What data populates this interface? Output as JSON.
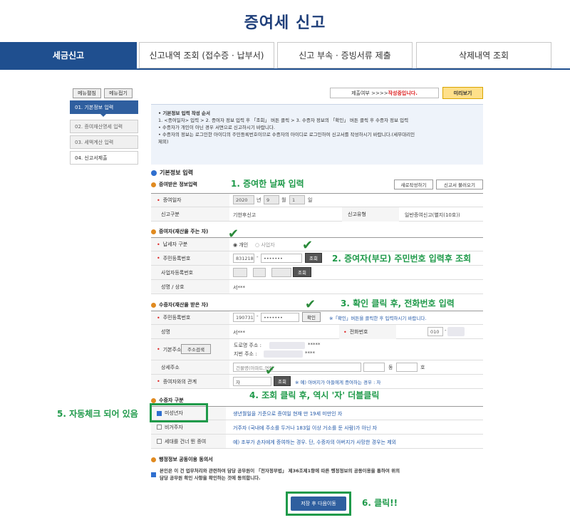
{
  "page_title": "증여세 신고",
  "tabs": [
    "세금신고",
    "신고내역 조회 (접수증 · 납부서)",
    "신고 부속 · 증빙서류 제출",
    "삭제내역 조회"
  ],
  "sidebar": {
    "expand": "메뉴펼침",
    "collapse": "메뉴접기",
    "steps": [
      "01. 기본정보 입력",
      "02. 증여재산명세 입력",
      "03. 세액계산 입력",
      "04. 신고서제출"
    ]
  },
  "status": {
    "label": "제출여부 >>>> ",
    "state": "작성중입니다.",
    "preview": "미리보기"
  },
  "info": {
    "heading": "• 기본정보 입력 작성 순서",
    "lines": [
      "1. <증여일자> 입력 > 2. 증여자 정보 입력 후 「조회」 버튼 클릭 > 3. 수증자 정보의 「확인」 버튼 클릭 후 수증자 정보 입력",
      "• 수증자가 개인이 아닌 경우 서면으로 신고하시기 바랍니다.",
      "• 수증자의 정보는 로그인한 아이디의 주민등록번호이므로 수증자의 아이디로 로그인하여 신고서를 작성하시기 바랍니다.(세무대리인",
      "제외)"
    ]
  },
  "basic": {
    "title": "기본정보 입력",
    "received": "증여받은 정보입력",
    "new_btn": "새로작성하기",
    "load_btn": "신고서 불러오기",
    "date_label": "증여일자",
    "year": "2020",
    "year_unit": "년",
    "month": "9",
    "month_unit": "월",
    "day": "1",
    "day_unit": "일",
    "type_label": "신고구분",
    "type_value": "기한후신고",
    "kind_label": "신고유형",
    "kind_value": "일반증여신고(별지(10호))"
  },
  "donor": {
    "title": "증여자(재산을 주는 자)",
    "payer_label": "납세자 구분",
    "opt_person": "개인",
    "opt_business": "사업자",
    "rrn_label": "주민등록번호",
    "rrn_front": "831218",
    "rrn_back": "•••••••",
    "lookup": "조회",
    "biz_label": "사업자등록번호",
    "biz_lookup": "조회",
    "name_label": "성명 / 상호",
    "name_value": "서***"
  },
  "recipient": {
    "title": "수증자(재산을 받은 자)",
    "rrn_label": "주민등록번호",
    "rrn_front": "190731",
    "rrn_back": "•••••••",
    "confirm": "확인",
    "confirm_note": "※「확인」버튼을 클릭한 후 입력하시기 바랍니다.",
    "name_label": "성명",
    "name_value": "서***",
    "phone_label": "전화번호",
    "phone_prefix": "010",
    "phone_dash": "-",
    "addr_label": "기본주소",
    "addr_btn": "주소검색",
    "road_addr": "도로명 주소 :",
    "jibun_addr": "지번 주소 :",
    "road_mask": "*****",
    "jibun_mask": "****",
    "detail_label": "상세주소",
    "building": "건물명(아파트,연립",
    "dong": "동",
    "ho": "호",
    "rel_label": "증여자와의 관계",
    "rel_value": "자",
    "rel_lookup": "조회",
    "rel_note": "※ 예) 아버지가 아들에게 증여하는 경우 : 자"
  },
  "recipient_type": {
    "title": "수증자 구분",
    "items": [
      {
        "label": "미성년자",
        "desc": "생년월일을 기준으로 증여일 현재 만 19세 미만인 자"
      },
      {
        "label": "비거주자",
        "desc": "거주자 (국내에 주소를 두거나 183일 이상 거소를 둔 사람)가 아닌 자"
      },
      {
        "label": "세대를 건너 뛴 증여",
        "desc": "예) 조부가 손자에게 증여하는 경우. 단, 수증자의 아버지가 사망한 경우는 제외"
      }
    ]
  },
  "consent": {
    "title": "행정정보 공동이용 동의서",
    "line1": "본인은 이 건 업무처리와 관련하여 담당 공무원이 「전자정부법」 제36조제1항에 따른 행정정보의 공동이용을 통하여 위의",
    "line2": "담당 공무원 확인 사항을 확인하는 것에 동의합니다."
  },
  "save_btn": "저장 후 다음이동",
  "annotations": {
    "a1": "1. 증여한 날짜 입력",
    "a2": "2. 증여자(부모) 주민번호 입력후 조회",
    "a3": "3. 확인 클릭 후, 전화번호 입력",
    "a4": "4. 조회 클릭 후, 역시 '자' 더블클릭",
    "a5": "5. 자동체크 되어 있음",
    "a6": "6. 클릭!!"
  },
  "colors": {
    "brand": "#1f4f8f",
    "annotation": "#1f9a4a"
  }
}
